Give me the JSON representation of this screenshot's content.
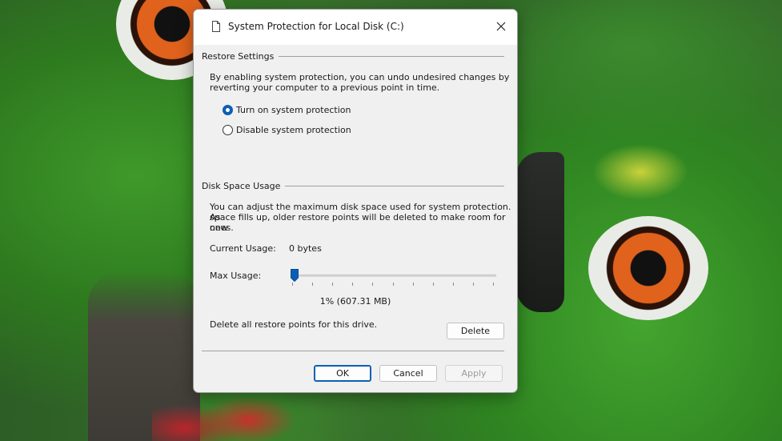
{
  "window": {
    "title": "System Protection for Local Disk  (C:)"
  },
  "restore_settings": {
    "label": "Restore Settings",
    "description_line1": "By enabling system protection, you can undo undesired changes by",
    "description_line2": "reverting your computer to a previous point in time.",
    "options": [
      {
        "label": "Turn on system protection",
        "checked": true
      },
      {
        "label": "Disable system protection",
        "checked": false
      }
    ]
  },
  "disk_space": {
    "label": "Disk Space Usage",
    "description_line1": "You can adjust the maximum disk space used for system protection. As",
    "description_line2": "space fills up, older restore points will be deleted to make room for new",
    "description_line3": "ones.",
    "current_usage_label": "Current Usage:",
    "current_usage_value": "0 bytes",
    "max_usage_label": "Max Usage:",
    "max_usage_fraction": 0.01,
    "max_usage_value": "1% (607.31 MB)",
    "delete_text": "Delete all restore points for this drive.",
    "delete_button": "Delete"
  },
  "footer": {
    "ok": "OK",
    "cancel": "Cancel",
    "apply": "Apply"
  },
  "colors": {
    "accent": "#0a5fb4",
    "dialog_bg": "#f0f0f0"
  },
  "icons": {
    "title": "document-icon",
    "close": "close-icon",
    "slider_thumb": "slider-thumb-icon"
  }
}
